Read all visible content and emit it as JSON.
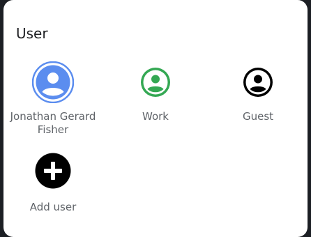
{
  "dialog": {
    "title": "User",
    "users": [
      {
        "label": "Jonathan Gerard Fisher",
        "color": "#5b8def",
        "selected": true
      },
      {
        "label": "Work",
        "color": "#34a853"
      },
      {
        "label": "Guest",
        "color": "#000000"
      }
    ],
    "add_user": {
      "label": "Add user",
      "color": "#000000"
    }
  }
}
